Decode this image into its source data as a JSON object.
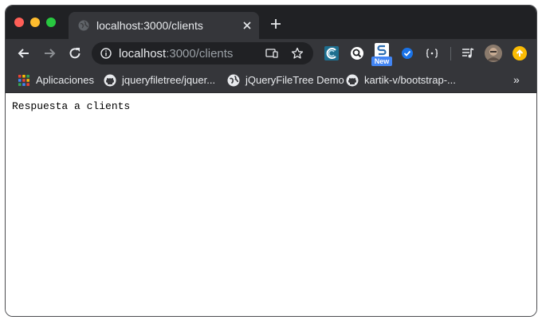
{
  "window": {
    "controls": [
      "close",
      "minimize",
      "zoom"
    ]
  },
  "tab": {
    "title": "localhost:3000/clients",
    "favicon": "globe-icon"
  },
  "toolbar": {
    "url_host": "localhost",
    "url_path": ":3000/clients",
    "extensions": [
      {
        "name": "colorzilla-icon"
      },
      {
        "name": "search-extension-icon"
      },
      {
        "name": "s-extension-icon",
        "badge": "New"
      },
      {
        "name": "check-shield-icon"
      },
      {
        "name": "bracket-extension-icon"
      }
    ]
  },
  "bookmarks": {
    "items": [
      {
        "label": "Aplicaciones",
        "icon": "apps-grid-icon"
      },
      {
        "label": "jqueryfiletree/jquer...",
        "icon": "github-icon"
      },
      {
        "label": "jQueryFileTree Demo",
        "icon": "globe-icon"
      },
      {
        "label": "kartik-v/bootstrap-...",
        "icon": "github-icon"
      }
    ],
    "more": "»"
  },
  "page": {
    "body_text": "Respuesta a clients"
  },
  "colors": {
    "titlebar": "#202124",
    "toolbar": "#35363a",
    "text_light": "#e8eaed",
    "text_dim": "#9aa0a6"
  }
}
